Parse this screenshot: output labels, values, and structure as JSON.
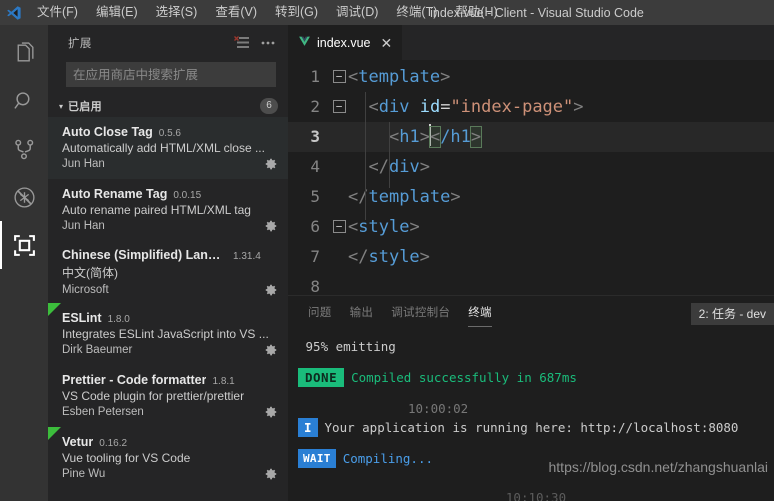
{
  "window": {
    "title": "index.vue - Client - Visual Studio Code",
    "logo_icon": "vscode-logo-icon"
  },
  "menubar": {
    "items": [
      {
        "label": "文件(F)",
        "name": "menu-file"
      },
      {
        "label": "编辑(E)",
        "name": "menu-edit"
      },
      {
        "label": "选择(S)",
        "name": "menu-selection"
      },
      {
        "label": "查看(V)",
        "name": "menu-view"
      },
      {
        "label": "转到(G)",
        "name": "menu-go"
      },
      {
        "label": "调试(D)",
        "name": "menu-debug"
      },
      {
        "label": "终端(T)",
        "name": "menu-terminal"
      },
      {
        "label": "帮助(H)",
        "name": "menu-help"
      }
    ]
  },
  "activitybar": {
    "items": [
      {
        "icon": "files-explorer-icon",
        "active": false
      },
      {
        "icon": "search-icon",
        "active": false
      },
      {
        "icon": "source-control-icon",
        "active": false
      },
      {
        "icon": "run-and-debug-icon",
        "active": false
      },
      {
        "icon": "extensions-icon",
        "active": true
      }
    ]
  },
  "sidebar": {
    "title": "扩展",
    "actions": [
      {
        "icon": "clear-filter-icon",
        "name": "clear-extensions-filter"
      },
      {
        "icon": "more-actions-icon",
        "name": "extensions-more-actions"
      }
    ],
    "search": {
      "placeholder": "在应用商店中搜索扩展",
      "value": ""
    },
    "section": {
      "label": "已启用",
      "count": "6",
      "expanded": true
    },
    "extensions": [
      {
        "name": "Auto Close Tag",
        "version": "0.5.6",
        "description": "Automatically add HTML/XML close ...",
        "publisher": "Jun Han",
        "flagged": false,
        "hovered": true
      },
      {
        "name": "Auto Rename Tag",
        "version": "0.0.15",
        "description": "Auto rename paired HTML/XML tag",
        "publisher": "Jun Han",
        "flagged": false,
        "hovered": false
      },
      {
        "name": "Chinese (Simplified) Langua...",
        "version": "1.31.4",
        "description": "中文(简体)",
        "publisher": "Microsoft",
        "flagged": false,
        "hovered": false
      },
      {
        "name": "ESLint",
        "version": "1.8.0",
        "description": "Integrates ESLint JavaScript into VS ...",
        "publisher": "Dirk Baeumer",
        "flagged": true,
        "hovered": false
      },
      {
        "name": "Prettier - Code formatter",
        "version": "1.8.1",
        "description": "VS Code plugin for prettier/prettier",
        "publisher": "Esben Petersen",
        "flagged": false,
        "hovered": false
      },
      {
        "name": "Vetur",
        "version": "0.16.2",
        "description": "Vue tooling for VS Code",
        "publisher": "Pine Wu",
        "flagged": true,
        "hovered": false
      }
    ]
  },
  "editor": {
    "tab": {
      "label": "index.vue",
      "icon": "vue-file-icon",
      "close_label": "✕",
      "active": true
    },
    "lines": [
      {
        "num": "1",
        "fold": "−",
        "indent_guides": 0,
        "current": false,
        "text": "<template>"
      },
      {
        "num": "2",
        "fold": "−",
        "indent_guides": 1,
        "current": false,
        "text": "  <div id=\"index-page\">"
      },
      {
        "num": "3",
        "fold": "",
        "indent_guides": 2,
        "current": true,
        "text": "    <h1></h1>"
      },
      {
        "num": "4",
        "fold": "",
        "indent_guides": 1,
        "current": false,
        "text": "  </div>"
      },
      {
        "num": "5",
        "fold": "",
        "indent_guides": 0,
        "current": false,
        "text": "</template>"
      },
      {
        "num": "6",
        "fold": "−",
        "indent_guides": 0,
        "current": false,
        "text": "<style>"
      },
      {
        "num": "7",
        "fold": "",
        "indent_guides": 0,
        "current": false,
        "text": "</style>"
      },
      {
        "num": "8",
        "fold": "",
        "indent_guides": 0,
        "current": false,
        "text": ""
      }
    ]
  },
  "panel": {
    "tabs": [
      {
        "label": "问题",
        "active": false
      },
      {
        "label": "输出",
        "active": false
      },
      {
        "label": "调试控制台",
        "active": false
      },
      {
        "label": "终端",
        "active": true
      }
    ],
    "terminal_selector": "2: 任务 - dev",
    "terminal": {
      "progress_line": " 95% emitting",
      "done_badge": "DONE",
      "done_text": "Compiled successfully in 687ms",
      "timestamp": "10:00:02",
      "info_badge": "I",
      "info_text": "Your application is running here: http://localhost:8080",
      "wait_badge": "WAIT",
      "wait_text": "Compiling...",
      "timestamp_cut": "10:10:30"
    }
  },
  "watermark": "https://blog.csdn.net/zhangshuanlai",
  "colors": {
    "accent_blue": "#2a7fd4",
    "success_green": "#1abc7b",
    "tag_blue": "#569cd6",
    "string_orange": "#ce9178",
    "attr_light_blue": "#9cdcfe",
    "titlebar_bg": "#3c3c3c",
    "sidebar_bg": "#252526",
    "editor_bg": "#1e1e1e",
    "activitybar_bg": "#333333"
  }
}
